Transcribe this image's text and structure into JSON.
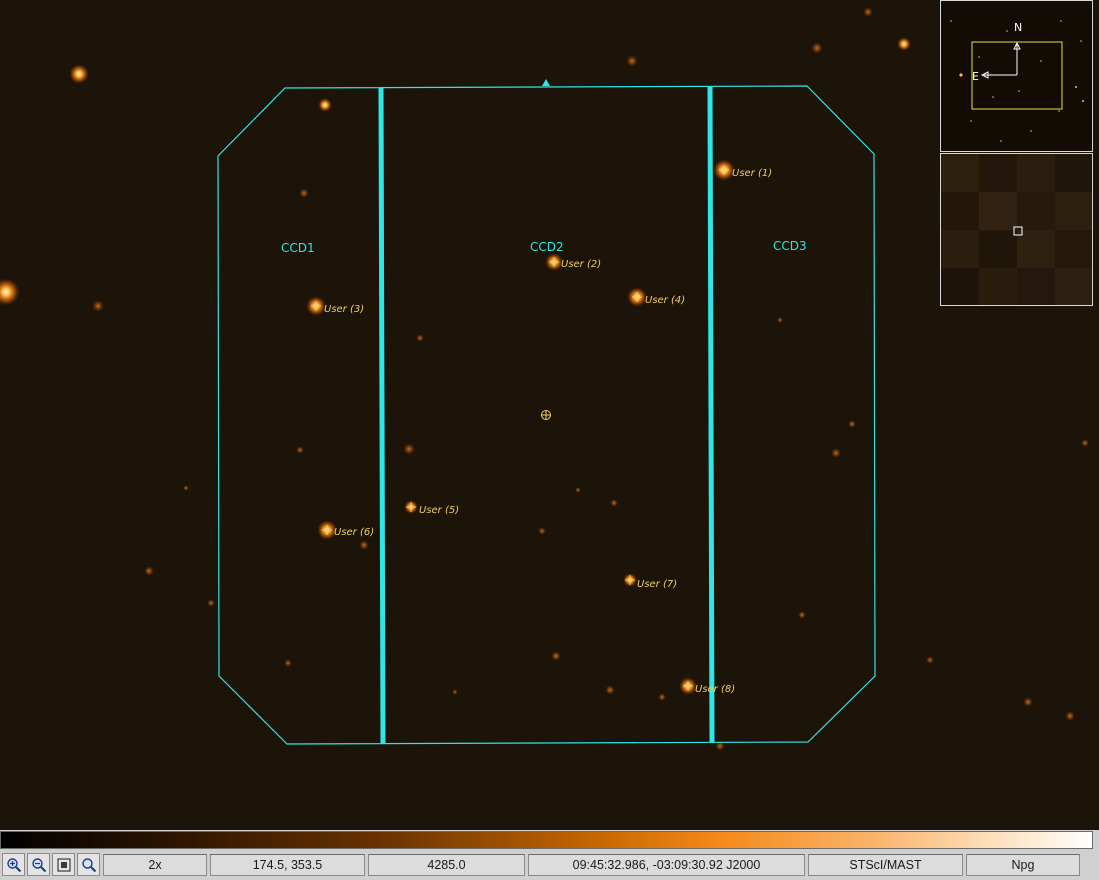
{
  "viewer": {
    "ccd_labels": [
      "CCD1",
      "CCD2",
      "CCD3"
    ],
    "markers": [
      {
        "label": "User (1)"
      },
      {
        "label": "User (2)"
      },
      {
        "label": "User (3)"
      },
      {
        "label": "User (4)"
      },
      {
        "label": "User (5)"
      },
      {
        "label": "User (6)"
      },
      {
        "label": "User (7)"
      },
      {
        "label": "User (8)"
      }
    ],
    "colors": {
      "background": "#1c1309",
      "footprint": "#2ee6e6",
      "marker": "#f0d060",
      "star": "#ff9a2e"
    }
  },
  "panner": {
    "north_label": "N",
    "east_label": "E"
  },
  "colorbar": {
    "colormap": "black-orange-white"
  },
  "status": {
    "tools": [
      {
        "name": "zoom-in-icon"
      },
      {
        "name": "zoom-out-icon"
      },
      {
        "name": "zoom-fit-icon"
      },
      {
        "name": "zoom-tool-icon"
      }
    ],
    "zoom": "2x",
    "pixel_coords": "174.5, 353.5",
    "pixel_value": "4285.0",
    "world_coords": "09:45:32.986, -03:09:30.92 J2000",
    "survey": "STScI/MAST",
    "band": "Npg"
  }
}
